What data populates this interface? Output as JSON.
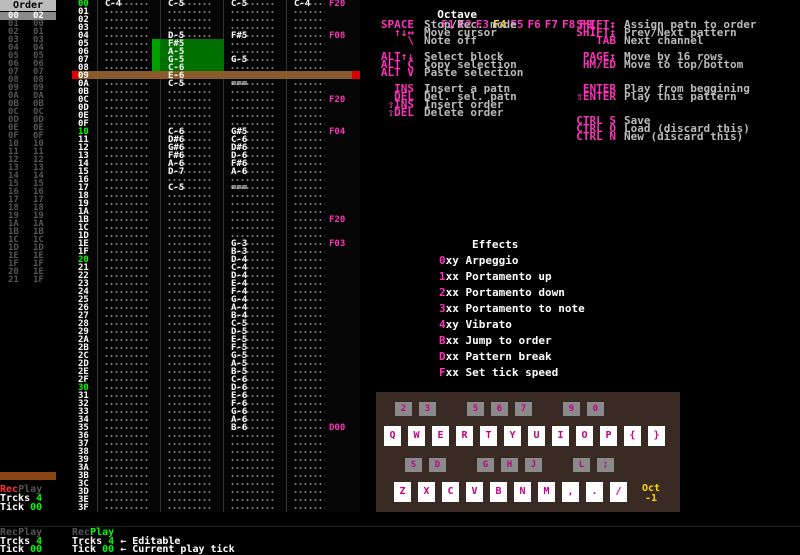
{
  "order": {
    "title": "Order",
    "rows": [
      [
        "00",
        "02"
      ],
      [
        "01",
        "00"
      ],
      [
        "02",
        "01"
      ],
      [
        "03",
        "03"
      ],
      [
        "04",
        "04"
      ],
      [
        "05",
        "05"
      ],
      [
        "06",
        "06"
      ],
      [
        "07",
        "07"
      ],
      [
        "08",
        "08"
      ],
      [
        "09",
        "09"
      ],
      [
        "0A",
        "0A"
      ],
      [
        "0B",
        "0B"
      ],
      [
        "0C",
        "0C"
      ],
      [
        "0D",
        "0D"
      ],
      [
        "0E",
        "0E"
      ],
      [
        "0F",
        "0F"
      ],
      [
        "10",
        "10"
      ],
      [
        "11",
        "11"
      ],
      [
        "12",
        "12"
      ],
      [
        "13",
        "13"
      ],
      [
        "14",
        "14"
      ],
      [
        "15",
        "15"
      ],
      [
        "16",
        "16"
      ],
      [
        "17",
        "17"
      ],
      [
        "18",
        "18"
      ],
      [
        "19",
        "19"
      ],
      [
        "1A",
        "1A"
      ],
      [
        "1B",
        "1B"
      ],
      [
        "1C",
        "1C"
      ],
      [
        "1D",
        "1D"
      ],
      [
        "1E",
        "1E"
      ],
      [
        "1F",
        "1F"
      ],
      [
        "20",
        "1E"
      ],
      [
        "21",
        "1F"
      ]
    ]
  },
  "pattern": {
    "rows": [
      {
        "i": "00",
        "n1": "C-4",
        "n2": "C-5",
        "n3": "C-5",
        "n4": "C-4",
        "fx": "F20"
      },
      {
        "i": "01"
      },
      {
        "i": "02"
      },
      {
        "i": "03"
      },
      {
        "i": "04",
        "n2": "D-5",
        "n3": "F#5",
        "fx": "F08"
      },
      {
        "i": "05",
        "n2": "F#5"
      },
      {
        "i": "06",
        "n2": "A-5"
      },
      {
        "i": "07",
        "n2": "G-5",
        "n3": "G-5"
      },
      {
        "i": "08",
        "n2": "C-6"
      },
      {
        "i": "09",
        "n2": "E-6"
      },
      {
        "i": "0A",
        "n2": "C-5",
        "n3": "==="
      },
      {
        "i": "0B"
      },
      {
        "i": "0C",
        "fx": "F20"
      },
      {
        "i": "0D"
      },
      {
        "i": "0E"
      },
      {
        "i": "0F"
      },
      {
        "i": "10",
        "n2": "C-6",
        "n3": "G#5",
        "fx": "F04"
      },
      {
        "i": "11",
        "n2": "D#6",
        "n3": "C-6"
      },
      {
        "i": "12",
        "n2": "G#6",
        "n3": "D#6"
      },
      {
        "i": "13",
        "n2": "F#6",
        "n3": "D-6"
      },
      {
        "i": "14",
        "n2": "A-6",
        "n3": "F#6"
      },
      {
        "i": "15",
        "n2": "D-7",
        "n3": "A-6"
      },
      {
        "i": "16"
      },
      {
        "i": "17",
        "n2": "C-5",
        "n3": "==="
      },
      {
        "i": "18"
      },
      {
        "i": "19"
      },
      {
        "i": "1A"
      },
      {
        "i": "1B",
        "fx": "F20"
      },
      {
        "i": "1C"
      },
      {
        "i": "1D"
      },
      {
        "i": "1E",
        "n3": "G-3",
        "fx": "F03"
      },
      {
        "i": "1F",
        "n3": "B-3"
      },
      {
        "i": "20",
        "n3": "D-4"
      },
      {
        "i": "21",
        "n3": "C-4"
      },
      {
        "i": "22",
        "n3": "D-4"
      },
      {
        "i": "23",
        "n3": "E-4"
      },
      {
        "i": "24",
        "n3": "F-4"
      },
      {
        "i": "25",
        "n3": "G-4"
      },
      {
        "i": "26",
        "n3": "A-4"
      },
      {
        "i": "27",
        "n3": "B-4"
      },
      {
        "i": "28",
        "n3": "C-5"
      },
      {
        "i": "29",
        "n3": "D-5"
      },
      {
        "i": "2A",
        "n3": "E-5"
      },
      {
        "i": "2B",
        "n3": "F-5"
      },
      {
        "i": "2C",
        "n3": "G-5"
      },
      {
        "i": "2D",
        "n3": "A-5"
      },
      {
        "i": "2E",
        "n3": "B-5"
      },
      {
        "i": "2F",
        "n3": "C-6"
      },
      {
        "i": "30",
        "n3": "D-6"
      },
      {
        "i": "31",
        "n3": "E-6"
      },
      {
        "i": "32",
        "n3": "F-6"
      },
      {
        "i": "33",
        "n3": "G-6"
      },
      {
        "i": "34",
        "n3": "A-6"
      },
      {
        "i": "35",
        "n3": "B-6",
        "fx": "D00"
      },
      {
        "i": "36"
      },
      {
        "i": "37"
      },
      {
        "i": "38"
      },
      {
        "i": "39"
      },
      {
        "i": "3A"
      },
      {
        "i": "3B"
      },
      {
        "i": "3C"
      },
      {
        "i": "3D"
      },
      {
        "i": "3E"
      },
      {
        "i": "3F"
      }
    ]
  },
  "help": {
    "octave_label": "Octave",
    "octave_keys": [
      "F1",
      "F2",
      "F3",
      "F4",
      "F5",
      "F6",
      "F7",
      "F8",
      "F9"
    ],
    "left": [
      [
        "SPACE",
        "Stop/Rec. mode"
      ],
      [
        "↑↓↔",
        "Move cursor"
      ],
      [
        "\\",
        "Note off"
      ],
      [
        "",
        ""
      ],
      [
        "ALT↑↓",
        "Select block"
      ],
      [
        "ALT C",
        "Copy selection"
      ],
      [
        "ALT V",
        "Paste selection"
      ],
      [
        "",
        ""
      ],
      [
        "INS",
        "Insert a patn"
      ],
      [
        "DEL",
        "Del. sel. patn"
      ],
      [
        "⇧INS",
        "Insert order"
      ],
      [
        "⇧DEL",
        "Delete order"
      ]
    ],
    "right": [
      [
        "SHIFT↕",
        "Assign patn to order"
      ],
      [
        "SHIFT↕",
        "Prev/Next pattern"
      ],
      [
        "TAB",
        "Next channel"
      ],
      [
        "",
        ""
      ],
      [
        "PAGE↕",
        "Move by 16 rows"
      ],
      [
        "HM/ED",
        "Move to top/bottom"
      ],
      [
        "",
        ""
      ],
      [
        "",
        ""
      ],
      [
        "ENTER",
        "Play from beggining"
      ],
      [
        "⇧ENTER",
        "Play this pattern"
      ],
      [
        "",
        ""
      ],
      [
        "",
        ""
      ],
      [
        "CTRL S",
        "Save"
      ],
      [
        "CTRL O",
        "Load (discard this)"
      ],
      [
        "CTRL N",
        "New (discard this)"
      ]
    ]
  },
  "effects": {
    "title": "Effects",
    "items": [
      [
        "0",
        "xy",
        "Arpeggio"
      ],
      [
        "1",
        "xx",
        "Portamento up"
      ],
      [
        "2",
        "xx",
        "Portamento down"
      ],
      [
        "3",
        "xx",
        "Portamento to note"
      ],
      [
        "4",
        "xy",
        "Vibrato"
      ],
      [
        "B",
        "xx",
        "Jump to order"
      ],
      [
        "D",
        "xx",
        "Pattern break"
      ],
      [
        "F",
        "xx",
        "Set tick speed"
      ]
    ]
  },
  "keyboard": {
    "black": [
      "2",
      "3",
      "",
      "5",
      "6",
      "7",
      "",
      "9",
      "0"
    ],
    "upper": [
      "Q",
      "W",
      "E",
      "R",
      "T",
      "Y",
      "U",
      "I",
      "O",
      "P",
      "{",
      "}"
    ],
    "black2": [
      "S",
      "D",
      "",
      "G",
      "H",
      "J",
      "",
      "L",
      ";"
    ],
    "lower": [
      "Z",
      "X",
      "C",
      "V",
      "B",
      "N",
      "M",
      ",",
      ".",
      "/"
    ],
    "oct_label": "Oct",
    "oct_value": "-1"
  },
  "status": {
    "rec": "Rec",
    "play": "Play",
    "trcks_label": "Trcks",
    "trcks_value": "4",
    "tick_label": "Tick",
    "tick_value": "00"
  },
  "legend": {
    "rec": "Rec",
    "play": "Play",
    "trcks_label": "Trcks",
    "trcks_value": "4",
    "tick_label": "Tick",
    "tick_value": "00",
    "rec2": "Rec",
    "play2": "Play",
    "trcks_label2": "Trcks",
    "trcks_value2": "4",
    "tick_label2": "Tick",
    "tick_value2": "00",
    "editable": "← Editable",
    "current": "← Current play tick"
  },
  "colors": {
    "accent": "#ff33bb",
    "fx_color": "#ffd700",
    "green": "#00ff00"
  }
}
